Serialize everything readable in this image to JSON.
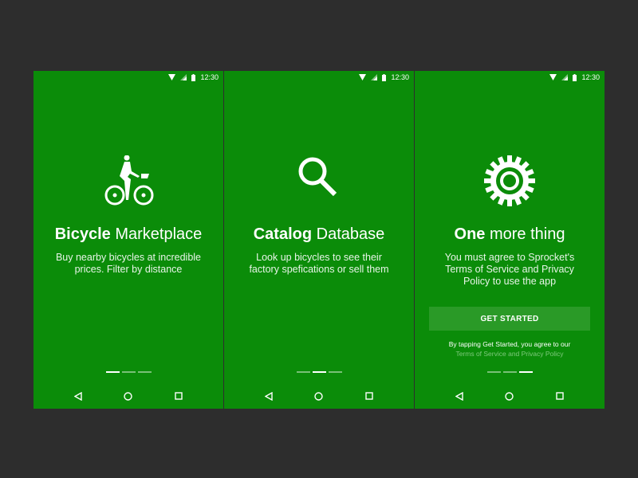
{
  "status": {
    "time": "12:30"
  },
  "screens": [
    {
      "title_bold": "Bicycle",
      "title_rest": " Marketplace",
      "body": "Buy nearby bicycles at incredible prices. Filter by distance",
      "icon": "bicycle-icon",
      "active_dot": 0
    },
    {
      "title_bold": "Catalog",
      "title_rest": " Database",
      "body": "Look up bicycles to see their factory spefications or sell them",
      "icon": "search-icon",
      "active_dot": 1
    },
    {
      "title_bold": "One",
      "title_rest": " more thing",
      "body": "You must agree to Sprocket's Terms of Service and Privacy Policy to use the app",
      "icon": "gear-icon",
      "active_dot": 2,
      "button": "GET STARTED",
      "agree_text": "By tapping Get Started, you agree to our",
      "agree_link": "Terms of Service and Privacy Policy"
    }
  ],
  "colors": {
    "primary": "#0b8c09",
    "background": "#2d2d2d"
  }
}
